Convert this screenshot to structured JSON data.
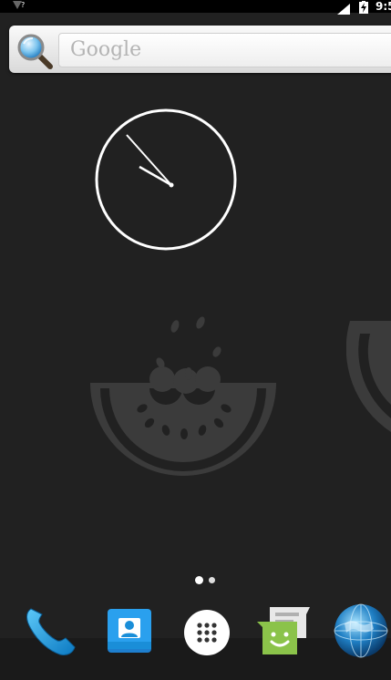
{
  "status_bar": {
    "signal_label": "?",
    "time": "9:5"
  },
  "search_widget": {
    "placeholder": "Google",
    "icon": "magnifier-icon"
  },
  "clock_widget": {
    "hour_hand_angle_deg": -60,
    "minute_hand_angle_deg": -35
  },
  "wallpaper": {
    "motif": "watermelon-slice"
  },
  "home_pages": {
    "count": 2,
    "current": 1
  },
  "dock": {
    "items": [
      {
        "name": "phone",
        "icon": "phone-icon"
      },
      {
        "name": "contacts",
        "icon": "contacts-icon"
      },
      {
        "name": "app-drawer",
        "icon": "app-drawer-icon"
      },
      {
        "name": "messaging",
        "icon": "messaging-icon"
      },
      {
        "name": "browser",
        "icon": "globe-icon"
      }
    ]
  },
  "colors": {
    "background": "#212121",
    "wallpaper_motif": "#3b3b3b",
    "status_bar": "#000000",
    "phone_blue": "#1e9fe0",
    "contacts_blue": "#1a8ed8",
    "messaging_green": "#8bc34a"
  }
}
